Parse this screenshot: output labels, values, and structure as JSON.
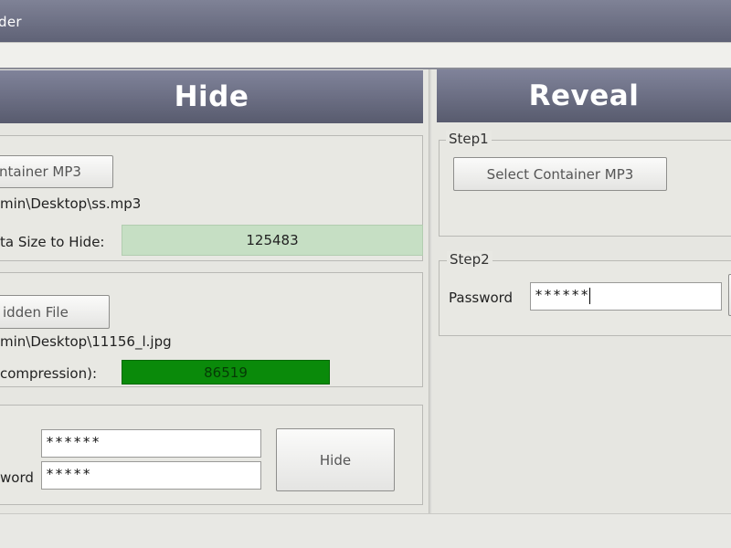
{
  "window": {
    "title": "der"
  },
  "hide_panel": {
    "banner": "Hide",
    "step1": {
      "select_button": "ntainer MP3",
      "file_path": "min\\Desktop\\ss.mp3",
      "size_label": "ta Size to Hide:",
      "size_value": "125483"
    },
    "step2": {
      "select_button": "idden File",
      "file_path": "min\\Desktop\\11156_l.jpg",
      "size_label": "compression):",
      "size_value": "86519"
    },
    "step3": {
      "password_value": "******",
      "confirm_label": "word",
      "confirm_value": "*****",
      "hide_button": "Hide"
    }
  },
  "reveal_panel": {
    "banner": "Reveal",
    "step1": {
      "legend": "Step1",
      "select_button": "Select Container MP3"
    },
    "step2": {
      "legend": "Step2",
      "password_label": "Password",
      "password_value": "******"
    }
  },
  "colors": {
    "banner": "#6a6d82",
    "size_box_light": "#c6dfc4",
    "size_box_dark": "#0a8a0a"
  }
}
